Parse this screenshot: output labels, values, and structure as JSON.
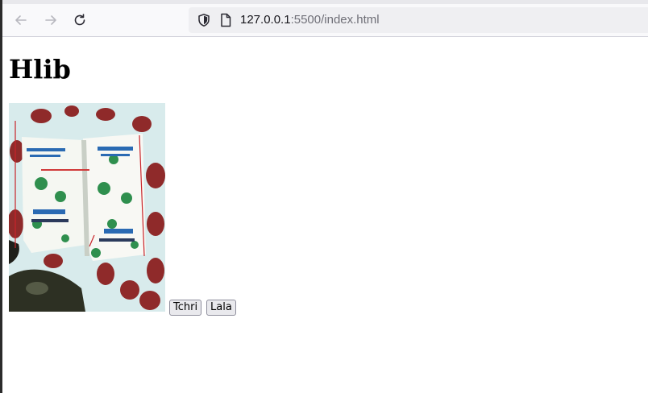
{
  "browser": {
    "url_host": "127.0.0.1",
    "url_rest": ":5500/index.html",
    "icons": {
      "back": "arrow-left-icon",
      "forward": "arrow-right-icon",
      "reload": "reload-icon",
      "shield": "shield-icon",
      "page": "page-icon"
    }
  },
  "page": {
    "heading": "Hlib",
    "buttons": {
      "tchri_label": "Tchri",
      "lala_label": "Lala"
    }
  }
}
